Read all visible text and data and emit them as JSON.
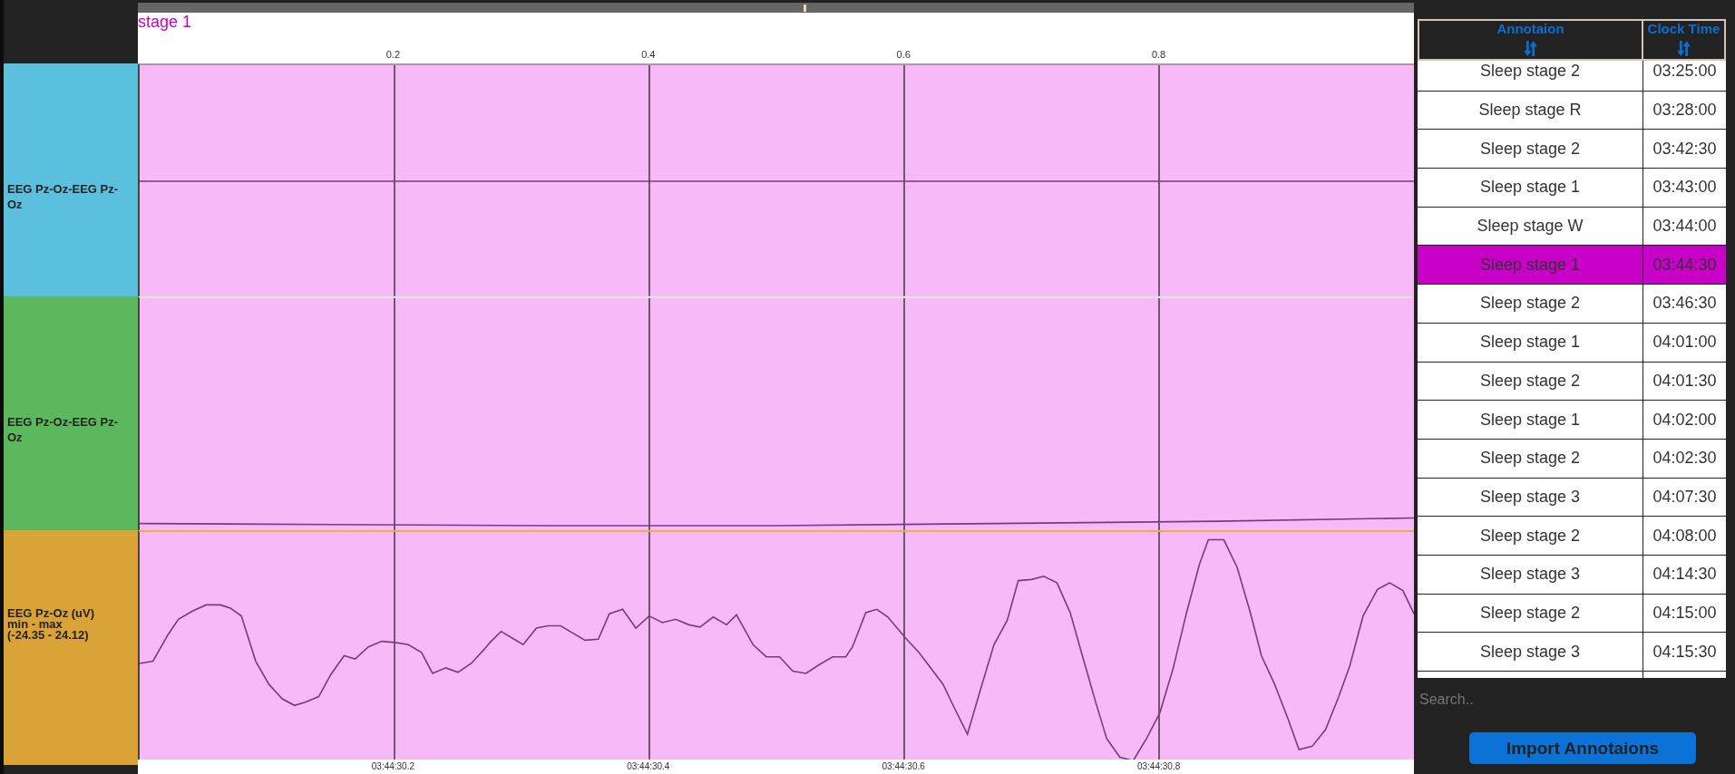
{
  "current_annotation": "stage 1",
  "top_axis": {
    "ticks": [
      "0.2",
      "0.4",
      "0.6",
      "0.8"
    ]
  },
  "channels": [
    {
      "label": "EEG Pz-Oz-EEG Pz-Oz",
      "color": "#5bc0de"
    },
    {
      "label": "EEG Pz-Oz-EEG Pz-Oz",
      "color": "#5cb85c"
    },
    {
      "label": "EEG Pz-Oz (uV)",
      "scale": "min - max",
      "range": "(-24.35 - 24.12)",
      "color": "#d9a337"
    }
  ],
  "bottom_axis": {
    "ticks": [
      "03:44:30.2",
      "03:44:30.4",
      "03:44:30.6",
      "03:44:30.8"
    ]
  },
  "annotations_table": {
    "columns": [
      {
        "label": "Annotaion"
      },
      {
        "label": "Clock Time"
      }
    ],
    "rows": [
      {
        "annotation": "Sleep stage 2",
        "clock_time": "03:25:00",
        "selected": false
      },
      {
        "annotation": "Sleep stage R",
        "clock_time": "03:28:00",
        "selected": false
      },
      {
        "annotation": "Sleep stage 2",
        "clock_time": "03:42:30",
        "selected": false
      },
      {
        "annotation": "Sleep stage 1",
        "clock_time": "03:43:00",
        "selected": false
      },
      {
        "annotation": "Sleep stage W",
        "clock_time": "03:44:00",
        "selected": false
      },
      {
        "annotation": "Sleep stage 1",
        "clock_time": "03:44:30",
        "selected": true
      },
      {
        "annotation": "Sleep stage 2",
        "clock_time": "03:46:30",
        "selected": false
      },
      {
        "annotation": "Sleep stage 1",
        "clock_time": "04:01:00",
        "selected": false
      },
      {
        "annotation": "Sleep stage 2",
        "clock_time": "04:01:30",
        "selected": false
      },
      {
        "annotation": "Sleep stage 1",
        "clock_time": "04:02:00",
        "selected": false
      },
      {
        "annotation": "Sleep stage 2",
        "clock_time": "04:02:30",
        "selected": false
      },
      {
        "annotation": "Sleep stage 3",
        "clock_time": "04:07:30",
        "selected": false
      },
      {
        "annotation": "Sleep stage 2",
        "clock_time": "04:08:00",
        "selected": false
      },
      {
        "annotation": "Sleep stage 3",
        "clock_time": "04:14:30",
        "selected": false
      },
      {
        "annotation": "Sleep stage 2",
        "clock_time": "04:15:00",
        "selected": false
      },
      {
        "annotation": "Sleep stage 3",
        "clock_time": "04:15:30",
        "selected": false
      }
    ]
  },
  "search": {
    "placeholder": "Search.."
  },
  "import_button": {
    "label": "Import Annotaions"
  }
}
